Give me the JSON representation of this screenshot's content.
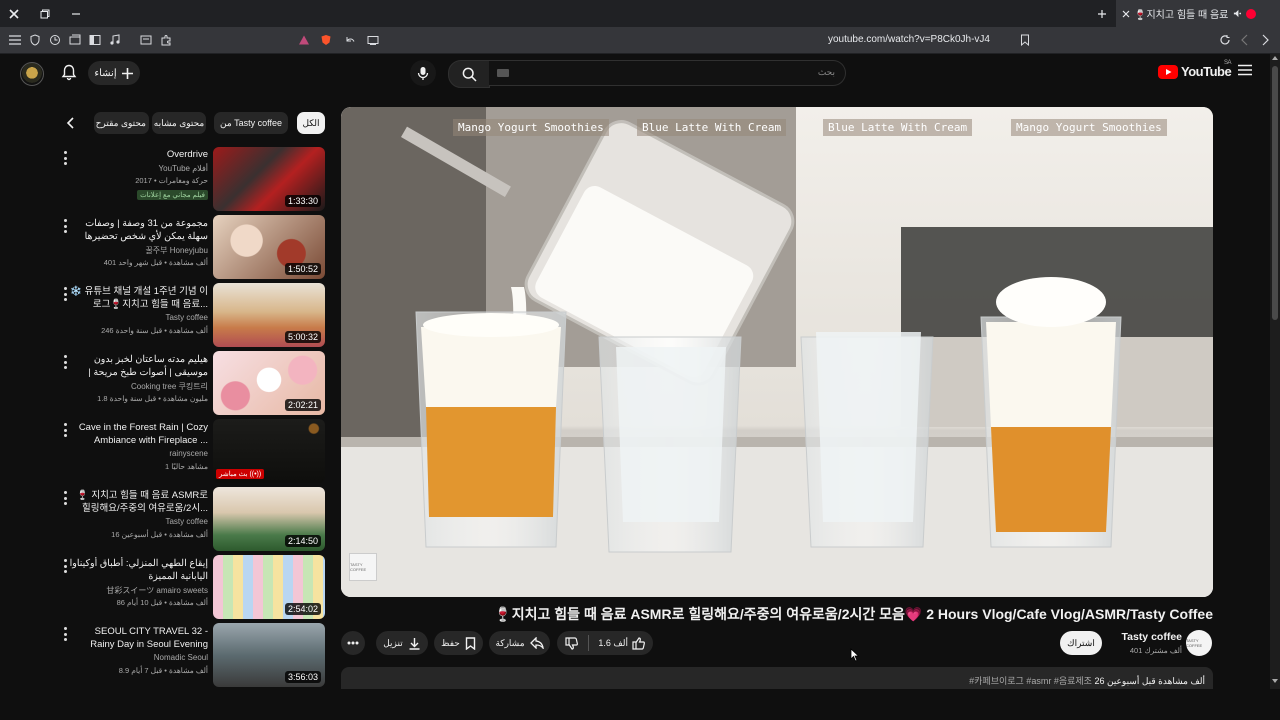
{
  "browser": {
    "tab_title": "🍷지치고 힘들 때 음료 ASMR",
    "url": "youtube.com/watch?v=P8Ck0Jh-vJ4"
  },
  "header": {
    "create_label": "إنشاء",
    "search_placeholder": "بحث",
    "logo_text": "YouTube",
    "region": "SA"
  },
  "chips": [
    {
      "label": "الكل",
      "active": true
    },
    {
      "label": "من Tasty coffee",
      "active": false
    },
    {
      "label": "محتوى مشابه",
      "active": false
    },
    {
      "label": "محتوى مقترح",
      "active": false
    }
  ],
  "related": [
    {
      "title": "Overdrive",
      "channel": "YouTube أفلام",
      "meta": "حركة ومغامرات • 2017",
      "badge": "فيلم مجاني مع إعلانات",
      "duration": "1:33:30"
    },
    {
      "title": "مجموعة من 31 وصفة | وصفات سهلة يمكن لأي شخص تحضيرها",
      "channel": "꿀주부 Honeyjubu",
      "meta": "401 ألف مشاهدة • قبل شهر واحد",
      "duration": "1:50:52"
    },
    {
      "title": "❄️ 유튜브 채널 개설 1주년 기념 이로그🍷지치고 힘들 때 음료...",
      "channel": "Tasty coffee",
      "meta": "246 ألف مشاهدة • قبل سنة واحدة",
      "duration": "5:00:32"
    },
    {
      "title": "هيليم مدته ساعتان لخبز بدون موسيقى | أصوات طبخ مريحة | كعكة الفراولة، كعكة ...",
      "channel": "Cooking tree 쿠킹트리",
      "meta": "1.8 مليون مشاهدة • قبل سنة واحدة",
      "duration": "2:02:21"
    },
    {
      "title": "Cave in the Forest Rain | Cozy Ambiance with Fireplace ...",
      "channel": "rainyscene",
      "meta": "1 مشاهد حاليًا",
      "badge_live": "بث مباشر ((•))",
      "duration": ""
    },
    {
      "title": "🍷 지치고 힘들 때 음료 ASMR로 힐링해요/주중의 여유로움/2시...",
      "channel": "Tasty coffee",
      "meta": "16 ألف مشاهدة • قبل أسبوعين",
      "duration": "2:14:50"
    },
    {
      "title": "إيقاع الطهي المنزلي: أطباق أوكيناوا اليابانية المميزة",
      "channel": "甘彩スイーツ  amairo sweets",
      "meta": "86 ألف مشاهدة • قبل 10 أيام",
      "duration": "2:54:02"
    },
    {
      "title": "SEOUL CITY TRAVEL 32 - Rainy Day in Seoul Evening Walk, ...",
      "channel": "Nomadic Seoul",
      "meta": "8.9 ألف مشاهدة • قبل 7 أيام",
      "duration": "3:56:03"
    }
  ],
  "video": {
    "labels": [
      "Mango Yogurt Smoothies",
      "Blue Latte With Cream",
      "Blue Latte With Cream",
      "Mango Yogurt Smoothies"
    ],
    "title": "🍷지치고 힘들 때 음료 ASMR로 힐링해요/주중의 여유로움/2시간 모음💗 2 Hours Vlog/Cafe Vlog/ASMR/Tasty Coffee",
    "watermark": "TASTY COFFEE"
  },
  "actions": {
    "likes": "1.6 ألف",
    "share": "مشاركة",
    "save": "حفظ",
    "download": "تنزيل"
  },
  "channel": {
    "name": "Tasty coffee",
    "subs": "401 ألف مشترك",
    "subscribe_label": "اشتراك",
    "avatar_text": "TASTY COFFEE"
  },
  "description": {
    "stats": "26 ألف مشاهدة قبل أسبوعين",
    "tags": "#카페브이로그 #asmr #음료제조"
  },
  "colors": {
    "brand_red": "#ff0000",
    "bg": "#0f0f0f",
    "chip": "#272727"
  }
}
